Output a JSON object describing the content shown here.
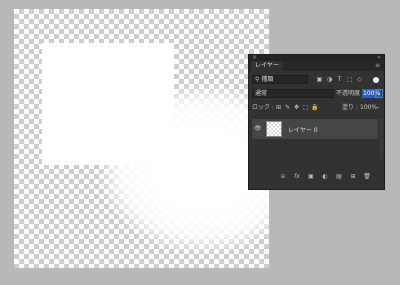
{
  "panel": {
    "title": "レイヤー",
    "menu_icon": "≡",
    "close_icon": "×",
    "collapse_icon": "»",
    "filter": {
      "label": "種類",
      "icon": "search-icon"
    },
    "filter_icons": [
      "▣",
      "◑",
      "T",
      "⬚",
      "◇"
    ],
    "blend_mode": "通常",
    "opacity_label": "不透明度 :",
    "opacity_value": "100%",
    "lock_label": "ロック :",
    "lock_icons": [
      "⊞",
      "✎",
      "✥",
      "⬚",
      "🔒"
    ],
    "fill_label": "塗り :",
    "fill_value": "100%",
    "layer": {
      "name": "レイヤー 0",
      "visible_icon": "👁"
    },
    "bottom_icons": [
      "⊝",
      "fx",
      "▣",
      "◐",
      "▤",
      "⊞",
      "🗑"
    ]
  },
  "colors": {
    "selection": "#2c5db8",
    "panel_bg": "#323232"
  }
}
